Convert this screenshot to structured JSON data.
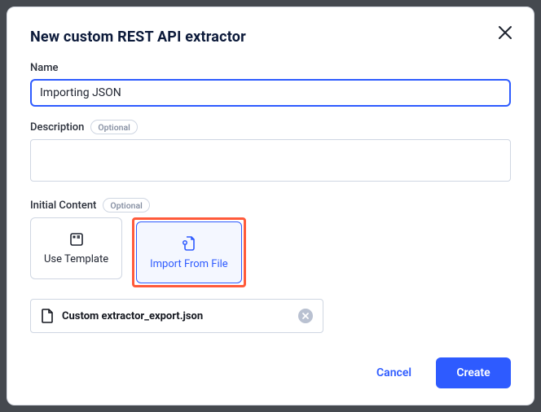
{
  "modal": {
    "title": "New custom REST API extractor"
  },
  "fields": {
    "name": {
      "label": "Name",
      "value": "Importing JSON"
    },
    "description": {
      "label": "Description",
      "optional": "Optional",
      "value": ""
    },
    "initialContent": {
      "label": "Initial Content",
      "optional": "Optional",
      "options": {
        "template": "Use Template",
        "importFile": "Import From File"
      },
      "file": {
        "name": "Custom extractor_export.json"
      }
    }
  },
  "footer": {
    "cancel": "Cancel",
    "create": "Create"
  }
}
